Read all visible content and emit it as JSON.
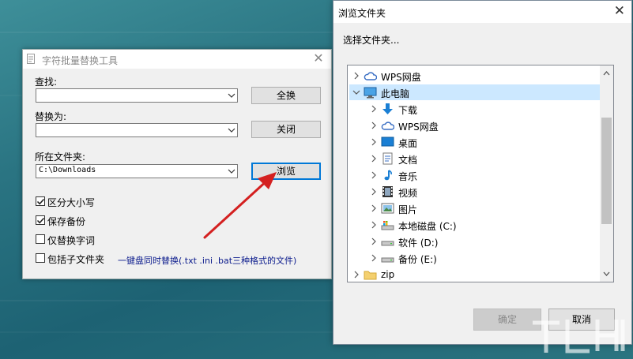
{
  "tool_window": {
    "title": "字符批量替换工具",
    "find_label": "查找:",
    "find_value": "",
    "replace_label": "替换为:",
    "replace_value": "",
    "folder_label": "所在文件夹:",
    "folder_value": "C:\\Downloads",
    "replace_all_button": "全换",
    "close_button": "关闭",
    "browse_button": "浏览",
    "options": [
      {
        "label": "区分大小写",
        "checked": true
      },
      {
        "label": "保存备份",
        "checked": true
      },
      {
        "label": "仅替换字词",
        "checked": false
      },
      {
        "label": "包括子文件夹",
        "checked": false
      }
    ],
    "note": "一键盘同时替换(.txt .ini .bat三种格式的文件)"
  },
  "browse_dialog": {
    "title": "浏览文件夹",
    "prompt": "选择文件夹...",
    "tree": [
      {
        "label": "WPS网盘",
        "icon": "cloud-icon",
        "level": 0,
        "expander": "collapsed"
      },
      {
        "label": "此电脑",
        "icon": "computer-icon",
        "level": 0,
        "expander": "expanded",
        "selected": true
      },
      {
        "label": "下载",
        "icon": "download-icon",
        "level": 1,
        "expander": "collapsed"
      },
      {
        "label": "WPS网盘",
        "icon": "cloud-icon",
        "level": 1,
        "expander": "collapsed"
      },
      {
        "label": "桌面",
        "icon": "desktop-icon",
        "level": 1,
        "expander": "collapsed"
      },
      {
        "label": "文档",
        "icon": "document-icon",
        "level": 1,
        "expander": "collapsed"
      },
      {
        "label": "音乐",
        "icon": "music-icon",
        "level": 1,
        "expander": "collapsed"
      },
      {
        "label": "视频",
        "icon": "video-icon",
        "level": 1,
        "expander": "collapsed"
      },
      {
        "label": "图片",
        "icon": "picture-icon",
        "level": 1,
        "expander": "collapsed"
      },
      {
        "label": "本地磁盘 (C:)",
        "icon": "system-drive-icon",
        "level": 1,
        "expander": "collapsed"
      },
      {
        "label": "软件 (D:)",
        "icon": "drive-icon",
        "level": 1,
        "expander": "collapsed"
      },
      {
        "label": "备份 (E:)",
        "icon": "drive-icon",
        "level": 1,
        "expander": "collapsed"
      },
      {
        "label": "zip",
        "icon": "folder-icon",
        "level": 0,
        "expander": "collapsed"
      }
    ],
    "ok_button": "确定",
    "cancel_button": "取消"
  },
  "colors": {
    "accent": "#0078d7",
    "selection": "#cce8ff",
    "annotation_arrow": "#d42020",
    "note_text": "#0a1a8c"
  }
}
